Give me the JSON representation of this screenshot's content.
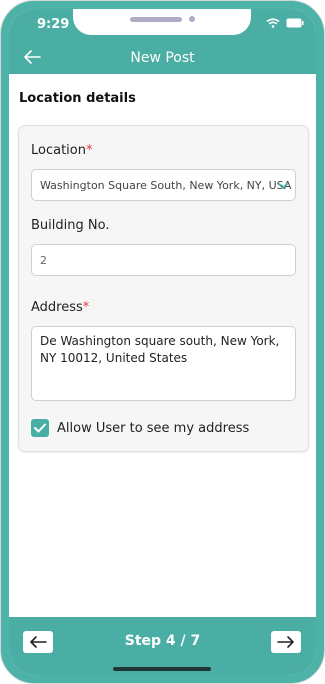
{
  "status_bar": {
    "time": "9:29"
  },
  "header": {
    "title": "New Post"
  },
  "section": {
    "title": "Location details"
  },
  "form": {
    "location": {
      "label": "Location",
      "required_mark": "*",
      "value": "Washington Square South, New York, NY, USA"
    },
    "building": {
      "label": "Building No.",
      "value": "2"
    },
    "address": {
      "label": "Address",
      "required_mark": "*",
      "value": "De Washington square south, New York, NY 10012, United States"
    },
    "allow_address": {
      "label": "Allow User to see my address",
      "checked": true
    }
  },
  "footer": {
    "step": "Step 4 / 7"
  },
  "colors": {
    "accent": "#4aaea4",
    "required": "#e53935"
  }
}
